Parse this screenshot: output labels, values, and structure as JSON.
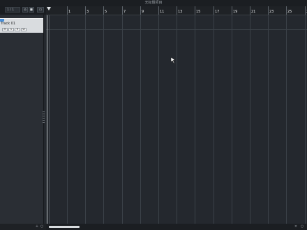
{
  "window": {
    "title": "无标题项目"
  },
  "toolbar": {
    "track_filter": "1 / 1",
    "home_icon": "home-icon",
    "settings_icon": "gear-icon",
    "folder_icon": "folder-icon"
  },
  "track": {
    "name": "Track 01",
    "color": "#4a90d9",
    "buttons": [
      "M",
      "S",
      "R",
      "W"
    ]
  },
  "ruler": {
    "labels": [
      "1",
      "3",
      "5",
      "7",
      "9",
      "11",
      "13",
      "15",
      "17",
      "19",
      "21",
      "23",
      "25",
      "27"
    ]
  },
  "scroll": {
    "left_label": "+",
    "right_label": "×"
  }
}
